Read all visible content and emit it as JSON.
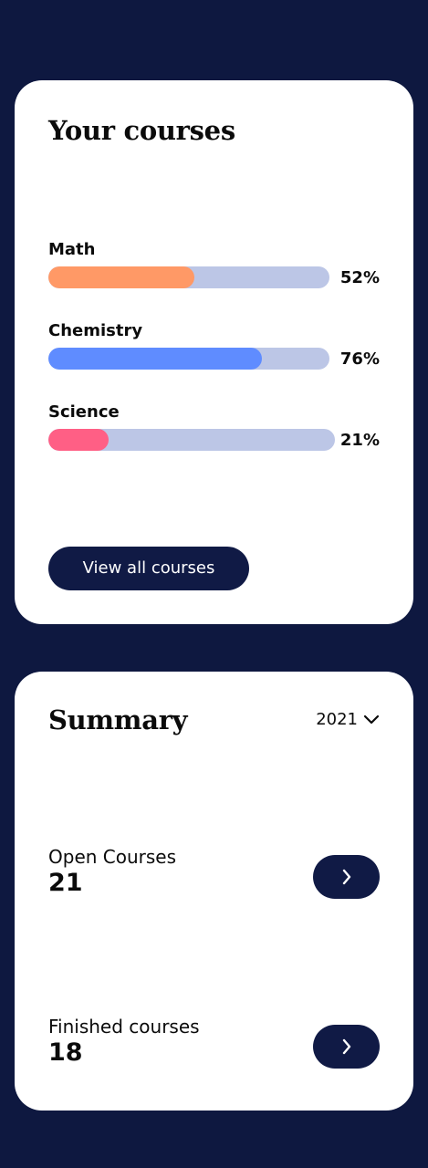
{
  "courses_card": {
    "title": "Your courses",
    "courses": [
      {
        "name": "Math",
        "progress": 52,
        "progress_label": "52%",
        "color": "#ff9966"
      },
      {
        "name": "Chemistry",
        "progress": 76,
        "progress_label": "76%",
        "color": "#5f8cff"
      },
      {
        "name": "Science",
        "progress": 21,
        "progress_label": "21%",
        "color": "#ff5f85"
      }
    ],
    "view_all_label": "View all courses"
  },
  "summary_card": {
    "title": "Summary",
    "year": "2021",
    "stats": [
      {
        "label": "Open Courses",
        "value": "21",
        "icon": "chevron-right-icon"
      },
      {
        "label": "Finished courses",
        "value": "18",
        "icon": "chevron-right-icon"
      }
    ]
  },
  "colors": {
    "background": "#0e1840",
    "accent": "#101a45",
    "track": "#bcc6e6"
  }
}
